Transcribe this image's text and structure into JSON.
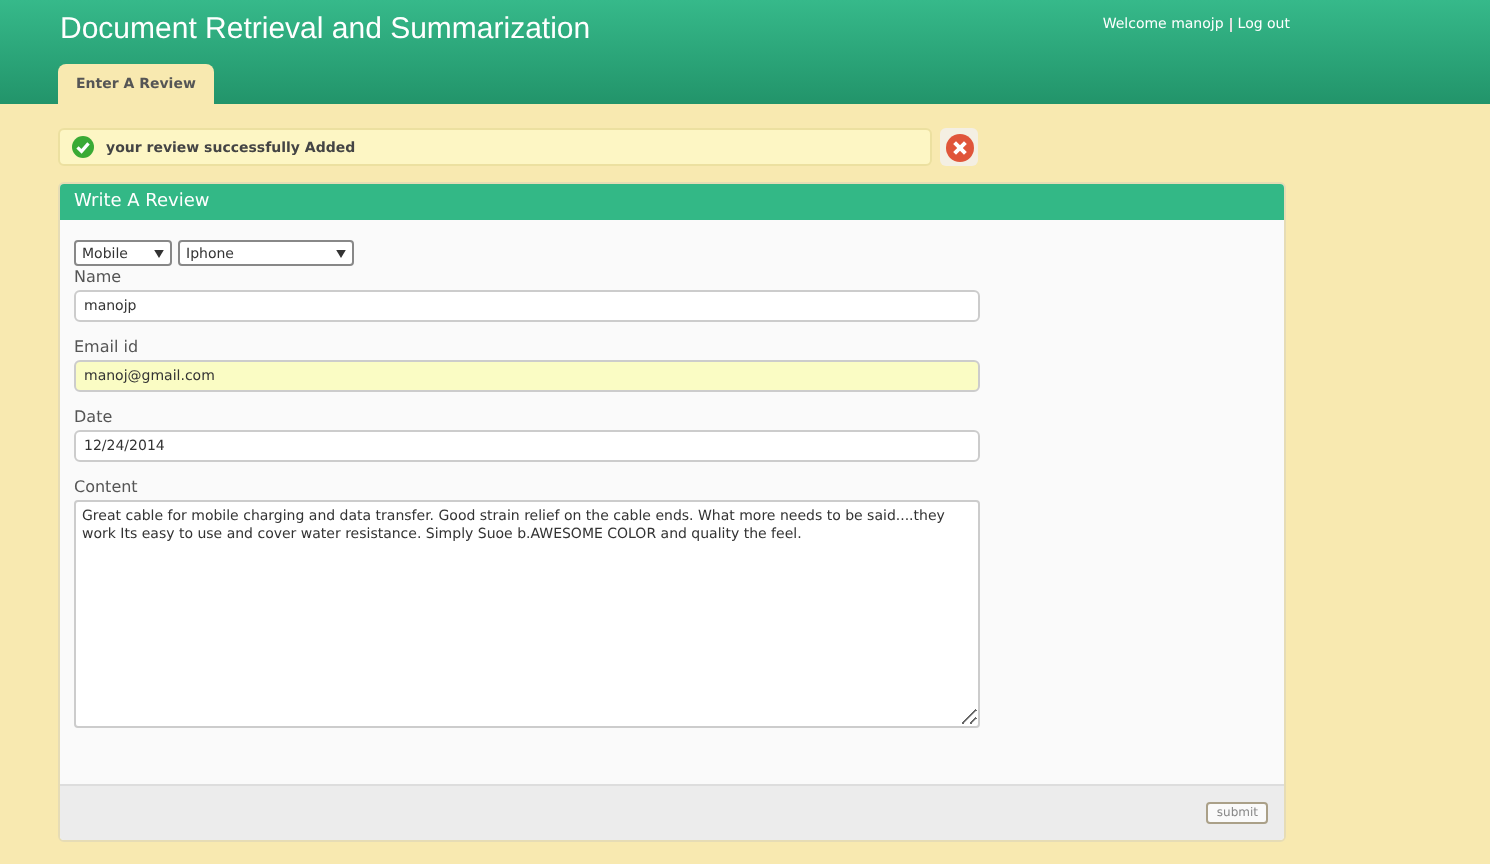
{
  "header": {
    "title": "Document Retrieval and Summarization",
    "welcome": "Welcome manojp",
    "logout": "Log out"
  },
  "tabs": [
    {
      "label": "Enter A Review",
      "selected": true
    }
  ],
  "message": {
    "text": "your review successfully Added"
  },
  "panel": {
    "title": "Write A Review",
    "selects": [
      {
        "value": "Mobile"
      },
      {
        "value": "Iphone"
      }
    ],
    "fields": [
      {
        "label": "Name",
        "value": "manojp",
        "highlighted": false
      },
      {
        "label": "Email id",
        "value": "manoj@gmail.com",
        "highlighted": true
      },
      {
        "label": "Date",
        "value": "12/24/2014",
        "highlighted": false
      }
    ],
    "content": {
      "label": "Content",
      "value": "Great cable for mobile charging and data transfer. Good strain relief on the cable ends. What more needs to be said....they work Its easy to use and cover water resistance. Simply Suoe b.AWESOME COLOR and quality the feel."
    },
    "submit": "submit"
  }
}
